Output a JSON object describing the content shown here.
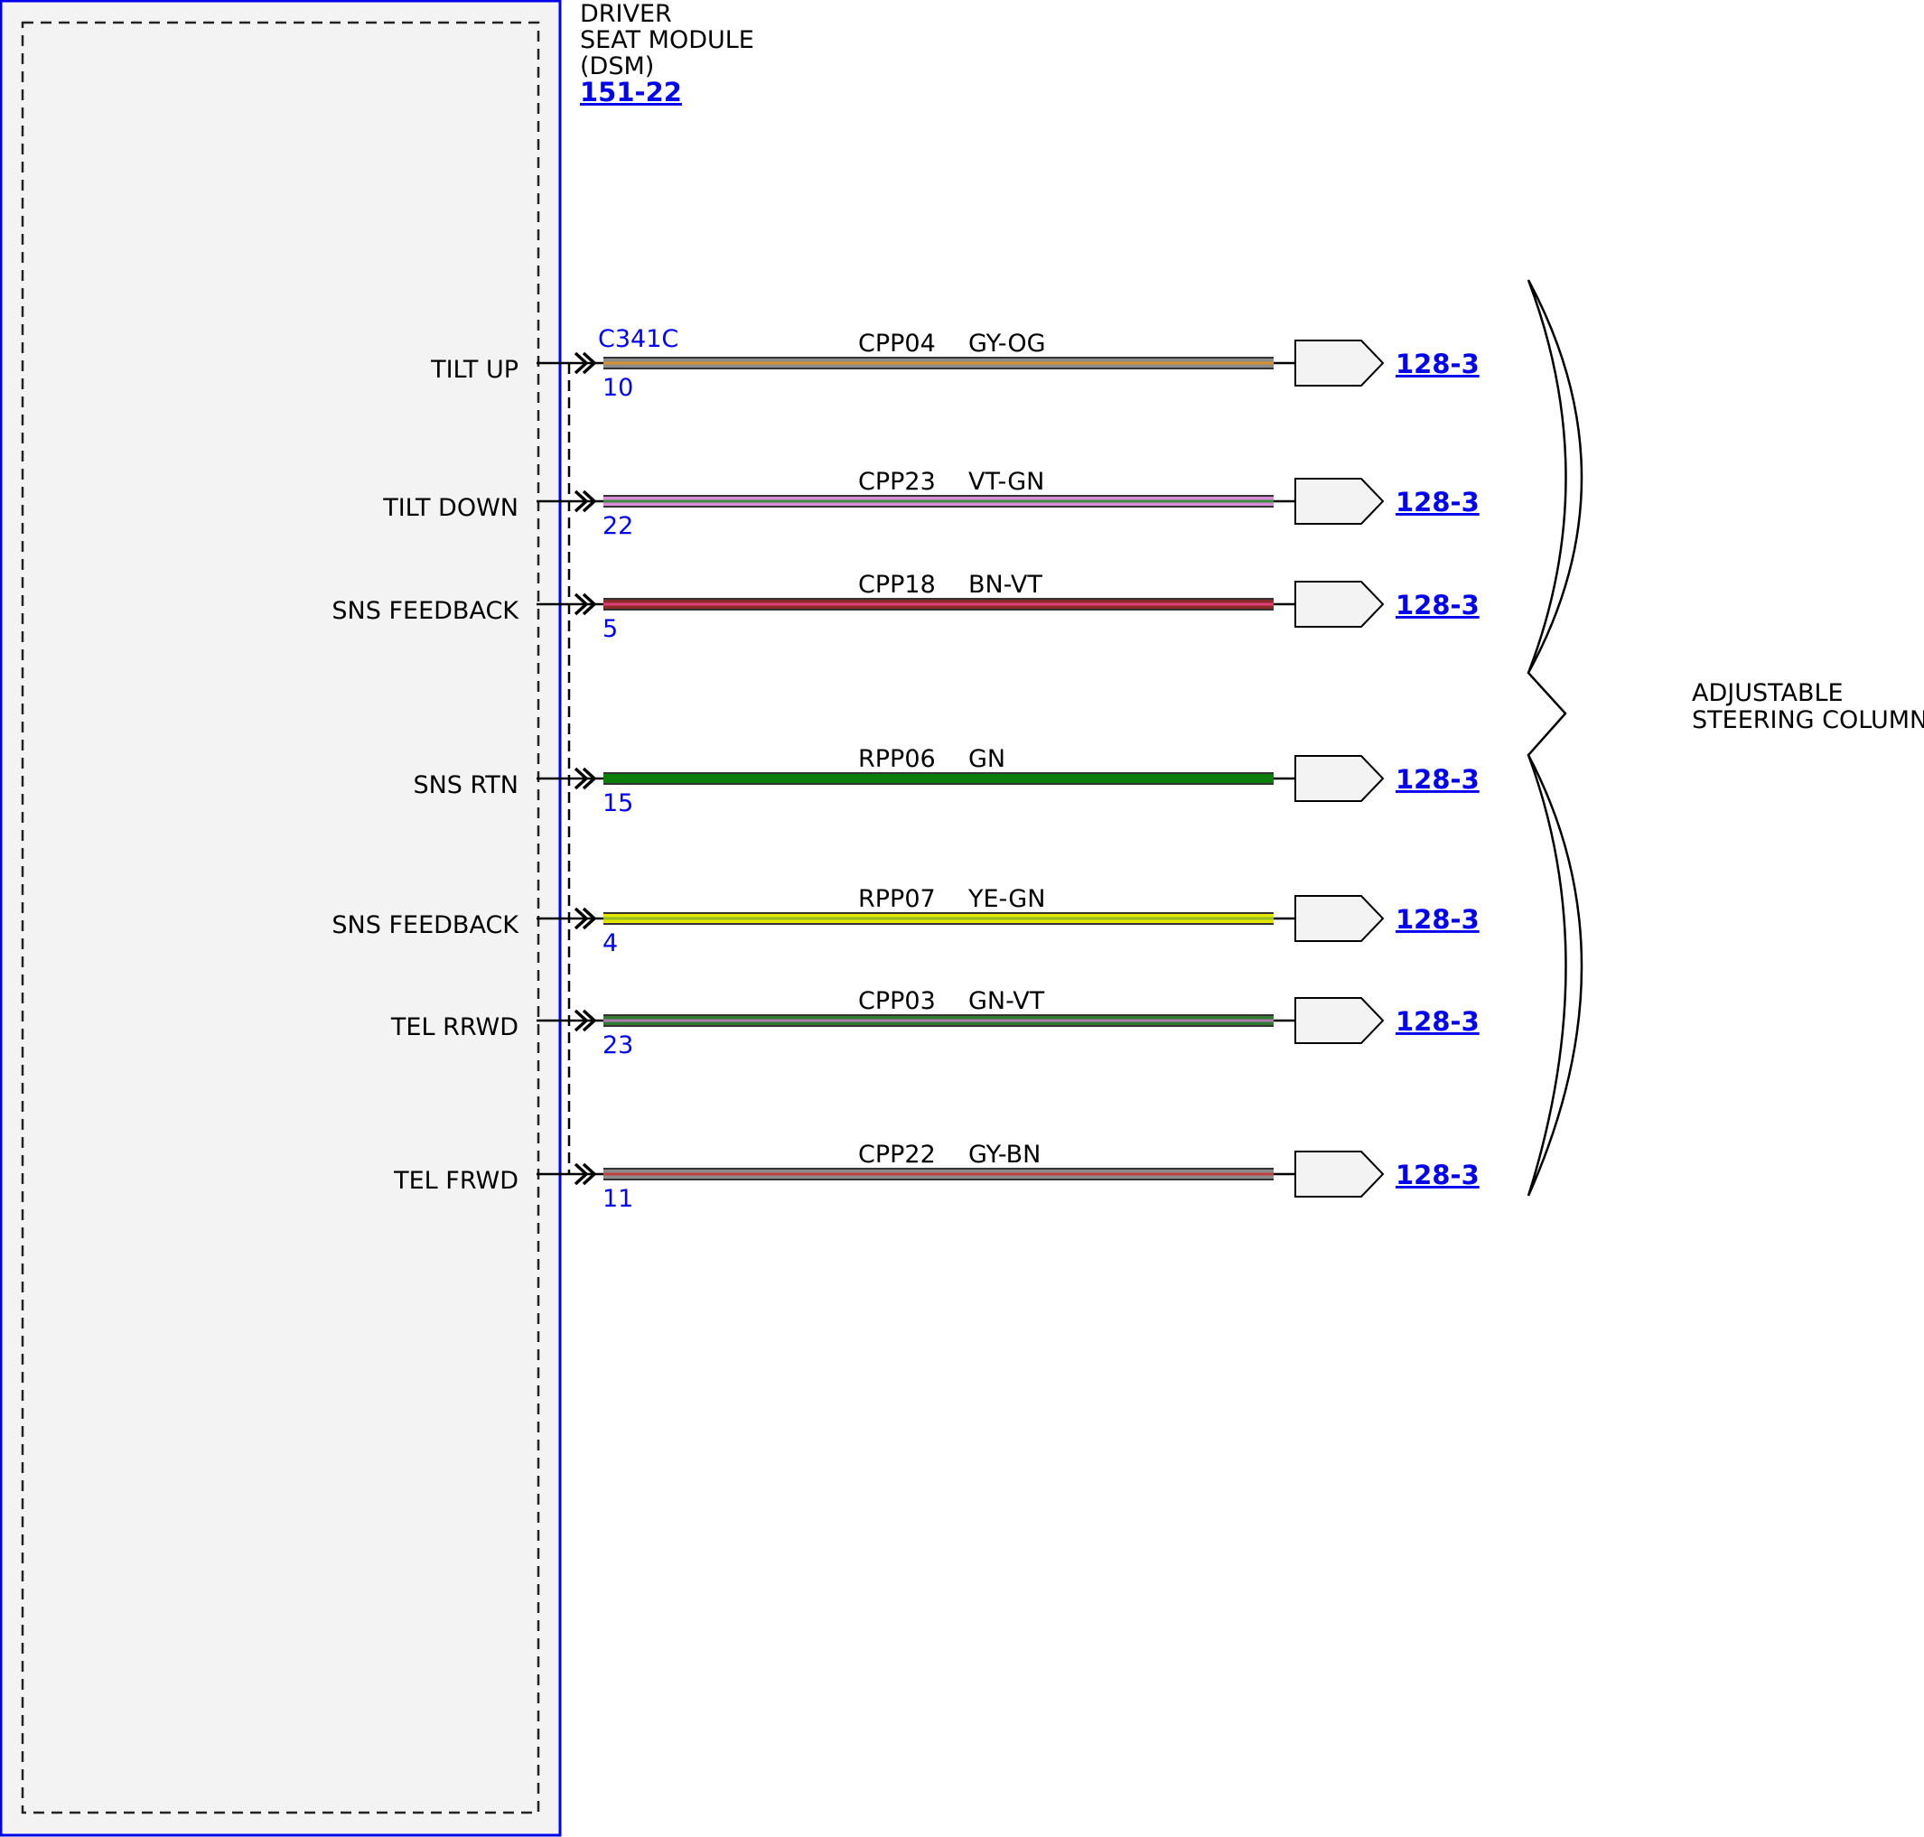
{
  "module": {
    "name_lines": [
      "DRIVER",
      "SEAT MODULE",
      "(DSM)"
    ],
    "ref": "151-22",
    "connector": "C341C"
  },
  "circuits": [
    {
      "signal": "TILT UP",
      "pin": "10",
      "circuit": "CPP04",
      "color_code": "GY-OG",
      "base_color": "#8c8c8c",
      "stripe_color": "#d9922a",
      "dest": "128-3"
    },
    {
      "signal": "TILT DOWN",
      "pin": "22",
      "circuit": "CPP23",
      "color_code": "VT-GN",
      "base_color": "#d98cd9",
      "stripe_color": "#3a8a3a",
      "dest": "128-3"
    },
    {
      "signal": "SNS FEEDBACK",
      "pin": "5",
      "circuit": "CPP18",
      "color_code": "BN-VT",
      "base_color": "#8b2a2a",
      "stripe_color": "#e0407a",
      "dest": "128-3"
    },
    {
      "signal": "SNS RTN",
      "pin": "15",
      "circuit": "RPP06",
      "color_code": "GN",
      "base_color": "#0b7d0b",
      "stripe_color": "#0b7d0b",
      "dest": "128-3"
    },
    {
      "signal": "SNS FEEDBACK",
      "pin": "4",
      "circuit": "RPP07",
      "color_code": "YE-GN",
      "base_color": "#e6e600",
      "stripe_color": "#8fbf20",
      "dest": "128-3"
    },
    {
      "signal": "TEL RRWD",
      "pin": "23",
      "circuit": "CPP03",
      "color_code": "GN-VT",
      "base_color": "#2f7a2f",
      "stripe_color": "#b07ab0",
      "dest": "128-3"
    },
    {
      "signal": "TEL FRWD",
      "pin": "11",
      "circuit": "CPP22",
      "color_code": "GY-BN",
      "base_color": "#8c8c8c",
      "stripe_color": "#c04040",
      "dest": "128-3"
    }
  ],
  "component": {
    "name_lines": [
      "ADJUSTABLE",
      "STEERING COLUMN"
    ]
  },
  "colors": {
    "module_border": "#0000ee",
    "module_fill": "#f3f3f3",
    "ref_text": "#0000ee",
    "line": "#000000"
  }
}
